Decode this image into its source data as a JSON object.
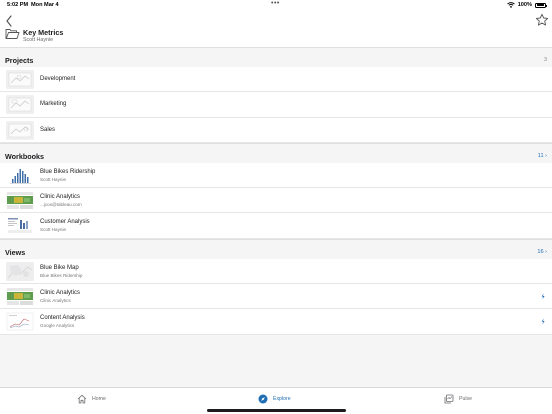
{
  "status_bar": {
    "time": "5:02 PM",
    "date": "Mon Mar 4",
    "battery": "100%"
  },
  "header": {
    "title": "Key Metrics",
    "subtitle": "Scott Haynie"
  },
  "projects": {
    "title": "Projects",
    "count": "3",
    "items": [
      {
        "label": "Development"
      },
      {
        "label": "Marketing"
      },
      {
        "label": "Sales"
      }
    ]
  },
  "workbooks": {
    "title": "Workbooks",
    "count": "11 ›",
    "items": [
      {
        "title": "Blue Bikes Ridership",
        "subtitle": "Scott Haynie"
      },
      {
        "title": "Clinic Analytics",
        "subtitle": "...jcox@tableau.com"
      },
      {
        "title": "Customer Analysis",
        "subtitle": "Scott Haynie"
      }
    ]
  },
  "views": {
    "title": "Views",
    "count": "16 ›",
    "items": [
      {
        "title": "Blue Bike Map",
        "subtitle": "Blue Bikes Ridership",
        "flag": false
      },
      {
        "title": "Clinic Analytics",
        "subtitle": "Clinic Analytics",
        "flag": true
      },
      {
        "title": "Content Analysis",
        "subtitle": "Google Analytics",
        "flag": true
      }
    ]
  },
  "tabs": [
    {
      "label": "Home",
      "icon": "home-icon"
    },
    {
      "label": "Explore",
      "icon": "compass-icon",
      "active": true
    },
    {
      "label": "Pulse",
      "icon": "pulse-icon"
    }
  ],
  "colors": {
    "accent": "#1f6fb5",
    "background": "#f5f5f6"
  }
}
